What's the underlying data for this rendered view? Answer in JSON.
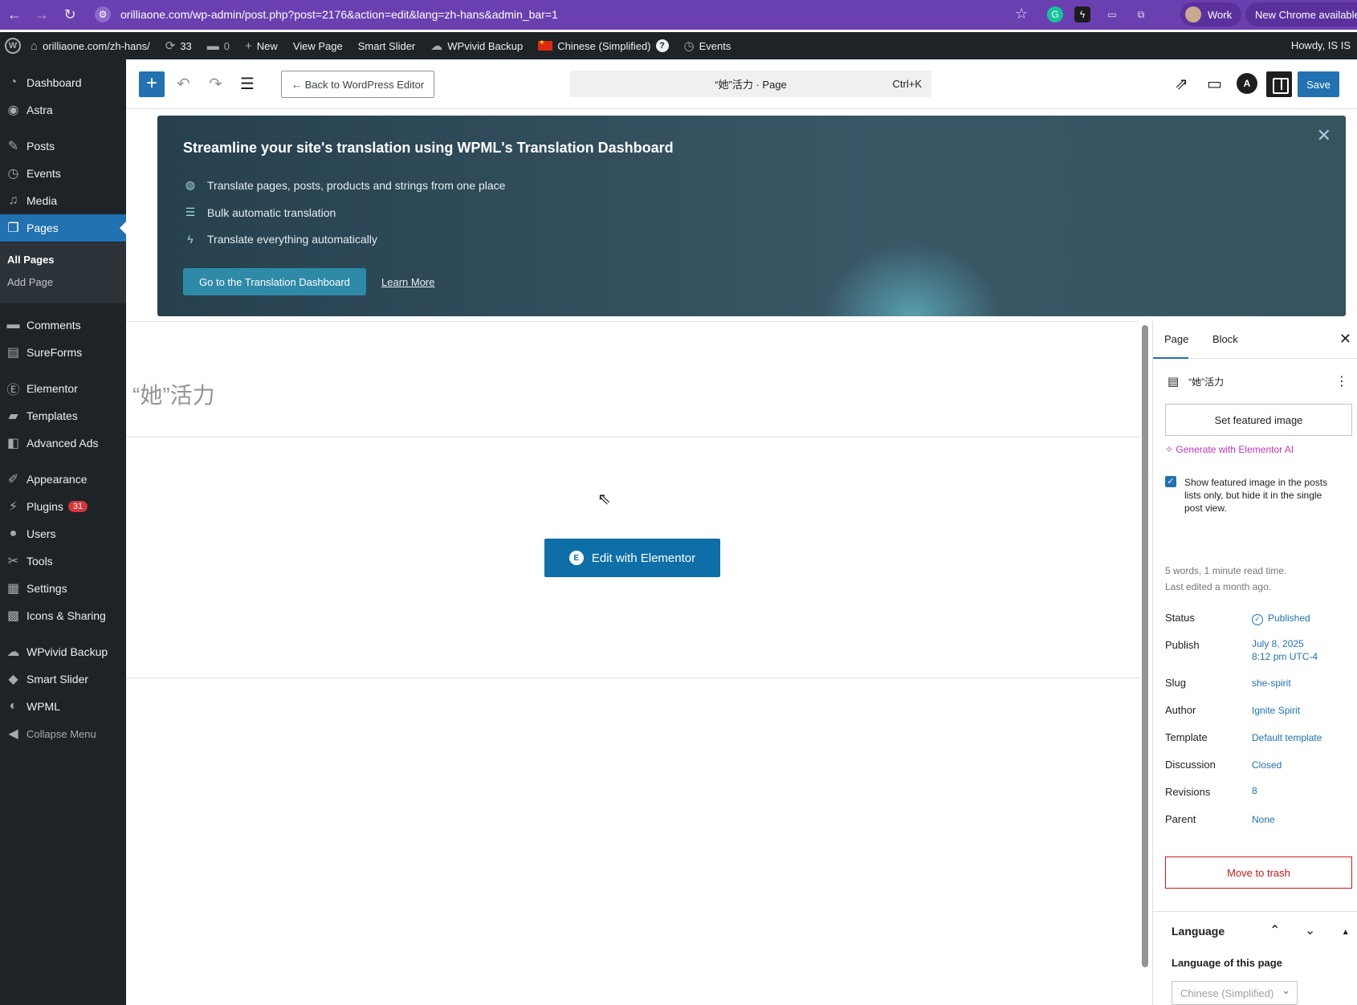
{
  "browser": {
    "url": "orilliaone.com/wp-admin/post.php?post=2176&action=edit&lang=zh-hans&admin_bar=1",
    "profile_label": "Work",
    "update_label": "New Chrome available"
  },
  "adminbar": {
    "site": "orilliaone.com/zh-hans/",
    "updates_count": "33",
    "comments_count": "0",
    "new_label": "New",
    "view_page": "View Page",
    "smart_slider": "Smart Slider",
    "wpvivid": "WPvivid Backup",
    "language": "Chinese (Simplified)",
    "language_help": "?",
    "events": "Events",
    "howdy": "Howdy, IS IS"
  },
  "sidebar": {
    "items": [
      {
        "label": "Dashboard",
        "icon": "dashboard-icon"
      },
      {
        "label": "Astra",
        "icon": "astra-icon"
      },
      {
        "label": "Posts",
        "icon": "pin-icon"
      },
      {
        "label": "Events",
        "icon": "calendar-icon"
      },
      {
        "label": "Media",
        "icon": "media-icon"
      },
      {
        "label": "Pages",
        "icon": "pages-icon"
      },
      {
        "label": "Comments",
        "icon": "comment-icon"
      },
      {
        "label": "SureForms",
        "icon": "form-icon"
      },
      {
        "label": "Elementor",
        "icon": "elementor-icon"
      },
      {
        "label": "Templates",
        "icon": "folder-icon"
      },
      {
        "label": "Advanced Ads",
        "icon": "ads-icon"
      },
      {
        "label": "Appearance",
        "icon": "brush-icon"
      },
      {
        "label": "Plugins",
        "icon": "plug-icon"
      },
      {
        "label": "Users",
        "icon": "user-icon"
      },
      {
        "label": "Tools",
        "icon": "wrench-icon"
      },
      {
        "label": "Settings",
        "icon": "settings-icon"
      },
      {
        "label": "Icons & Sharing",
        "icon": "grid-icon"
      },
      {
        "label": "WPvivid Backup",
        "icon": "cloud-icon"
      },
      {
        "label": "Smart Slider",
        "icon": "slider-icon"
      },
      {
        "label": "WPML",
        "icon": "wpml-icon"
      },
      {
        "label": "Collapse Menu",
        "icon": "collapse-icon"
      }
    ],
    "sub": {
      "all_pages": "All Pages",
      "add_page": "Add Page"
    },
    "plugins_badge": "31"
  },
  "editor_header": {
    "back_label": "← Back to WordPress Editor",
    "command_title": "“她”活力 · Page",
    "shortcut": "Ctrl+K",
    "save_label": "Save"
  },
  "promo": {
    "title": "Streamline your site's translation using WPML's Translation Dashboard",
    "features": [
      "Translate pages, posts, products and strings from one place",
      "Bulk automatic translation",
      "Translate everything automatically"
    ],
    "cta": "Go to the Translation Dashboard",
    "learn_more": "Learn More"
  },
  "canvas": {
    "page_title": "“她”活力",
    "edit_elementor": "Edit with Elementor"
  },
  "panel": {
    "tab_page": "Page",
    "tab_block": "Block",
    "doc_title": "“她”活力",
    "featured_image": "Set featured image",
    "generate_ai": "Generate with Elementor AI",
    "show_featured": "Show featured image in the posts lists only, but hide it in the single post view.",
    "words": "5 words, 1 minute read time.",
    "last_edited": "Last edited a month ago.",
    "rows": {
      "status": {
        "label": "Status",
        "value": "Published"
      },
      "publish": {
        "label": "Publish",
        "value": "July 8, 2025",
        "value2": "8:12 pm UTC-4"
      },
      "slug": {
        "label": "Slug",
        "value": "she-spirit"
      },
      "author": {
        "label": "Author",
        "value": "Ignite Spirit"
      },
      "template": {
        "label": "Template",
        "value": "Default template"
      },
      "discussion": {
        "label": "Discussion",
        "value": "Closed"
      },
      "revisions": {
        "label": "Revisions",
        "value": "8"
      },
      "parent": {
        "label": "Parent",
        "value": "None"
      }
    },
    "trash": "Move to trash",
    "language_heading": "Language",
    "language_sub": "Language of this page",
    "language_value": "Chinese (Simplified)"
  }
}
